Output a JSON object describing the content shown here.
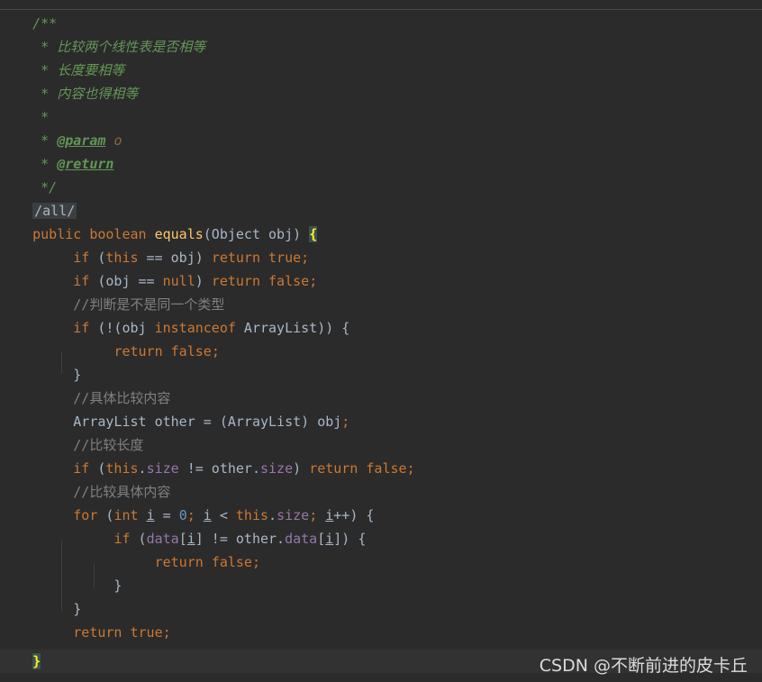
{
  "editor": {
    "doc_open": "/**",
    "doc_star": "*",
    "doc_line1": "比较两个线性表是否相等",
    "doc_line2": "长度要相等",
    "doc_line3": "内容也得相等",
    "doc_tag_param": "@param",
    "doc_param_name": "o",
    "doc_tag_return": "@return",
    "doc_close": "*/",
    "folded_annotation": "/all/",
    "kw_public": "public",
    "kw_boolean": "boolean",
    "method_name": "equals",
    "sig_rest": "(Object obj) ",
    "open_brace": "{",
    "close_brace": "}",
    "kw_if": "if",
    "kw_this": "this",
    "kw_return": "return",
    "kw_true": "true",
    "kw_false": "false",
    "kw_null": "null",
    "kw_instanceof": "instanceof",
    "kw_for": "for",
    "kw_int": "int",
    "comment_type_check": "//判断是不是同一个类型",
    "comment_content": "//具体比较内容",
    "comment_length": "//比较长度",
    "comment_content2": "//比较具体内容",
    "field_size": "size",
    "field_data": "data",
    "var_i": "i",
    "num_zero": "0",
    "semicolon": ";"
  },
  "watermark": "CSDN @不断前进的皮卡丘"
}
